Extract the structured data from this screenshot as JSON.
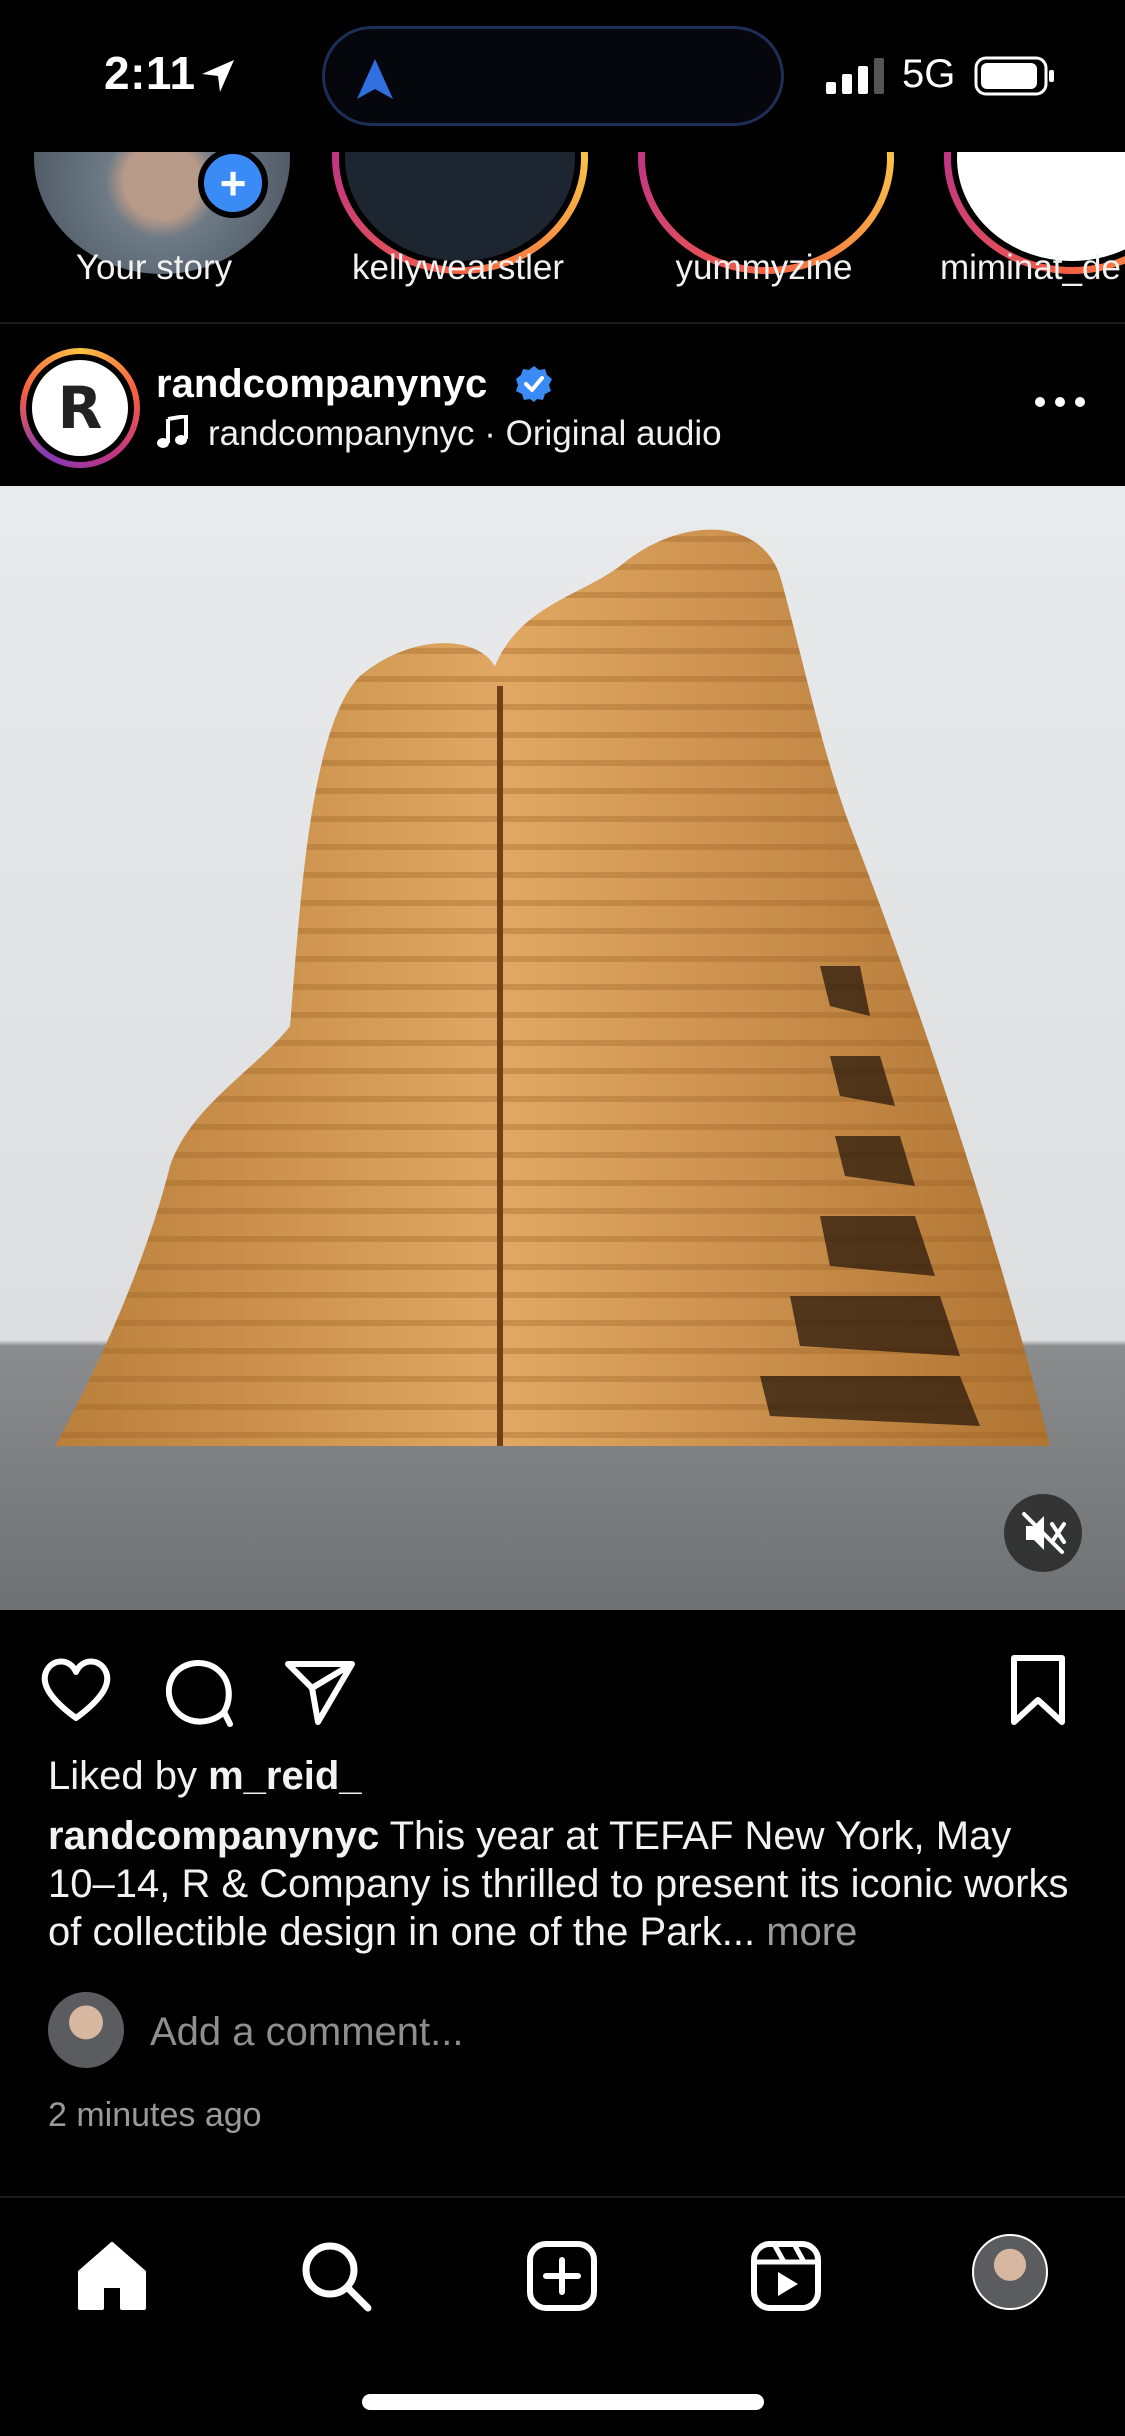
{
  "status_bar": {
    "time": "2:11",
    "network": "5G"
  },
  "stories": [
    {
      "label": "Your story"
    },
    {
      "label": "kellywearstler"
    },
    {
      "label": "yummyzine"
    },
    {
      "label": "miminat_de"
    }
  ],
  "post": {
    "username": "randcompanynyc",
    "audio": "randcompanynyc · Original audio",
    "avatar_letter": "R",
    "liked_prefix": "Liked by ",
    "liked_user": "m_reid_",
    "caption_user": "randcompanynyc",
    "caption_text": " This year at TEFAF New York, May 10–14, R & Company is thrilled to present its iconic works of collectible design in one of the Park... ",
    "caption_more": "more",
    "comment_placeholder": "Add a comment...",
    "timestamp": "2 minutes ago"
  },
  "colors": {
    "verified_blue": "#3a8bf5",
    "background": "#000000",
    "muted_text": "#9a9a9a"
  },
  "icons": {
    "actions": [
      "heart-icon",
      "comment-icon",
      "share-icon",
      "bookmark-icon"
    ],
    "tabs": [
      "home-icon",
      "search-icon",
      "create-icon",
      "reels-icon",
      "profile-avatar"
    ]
  }
}
